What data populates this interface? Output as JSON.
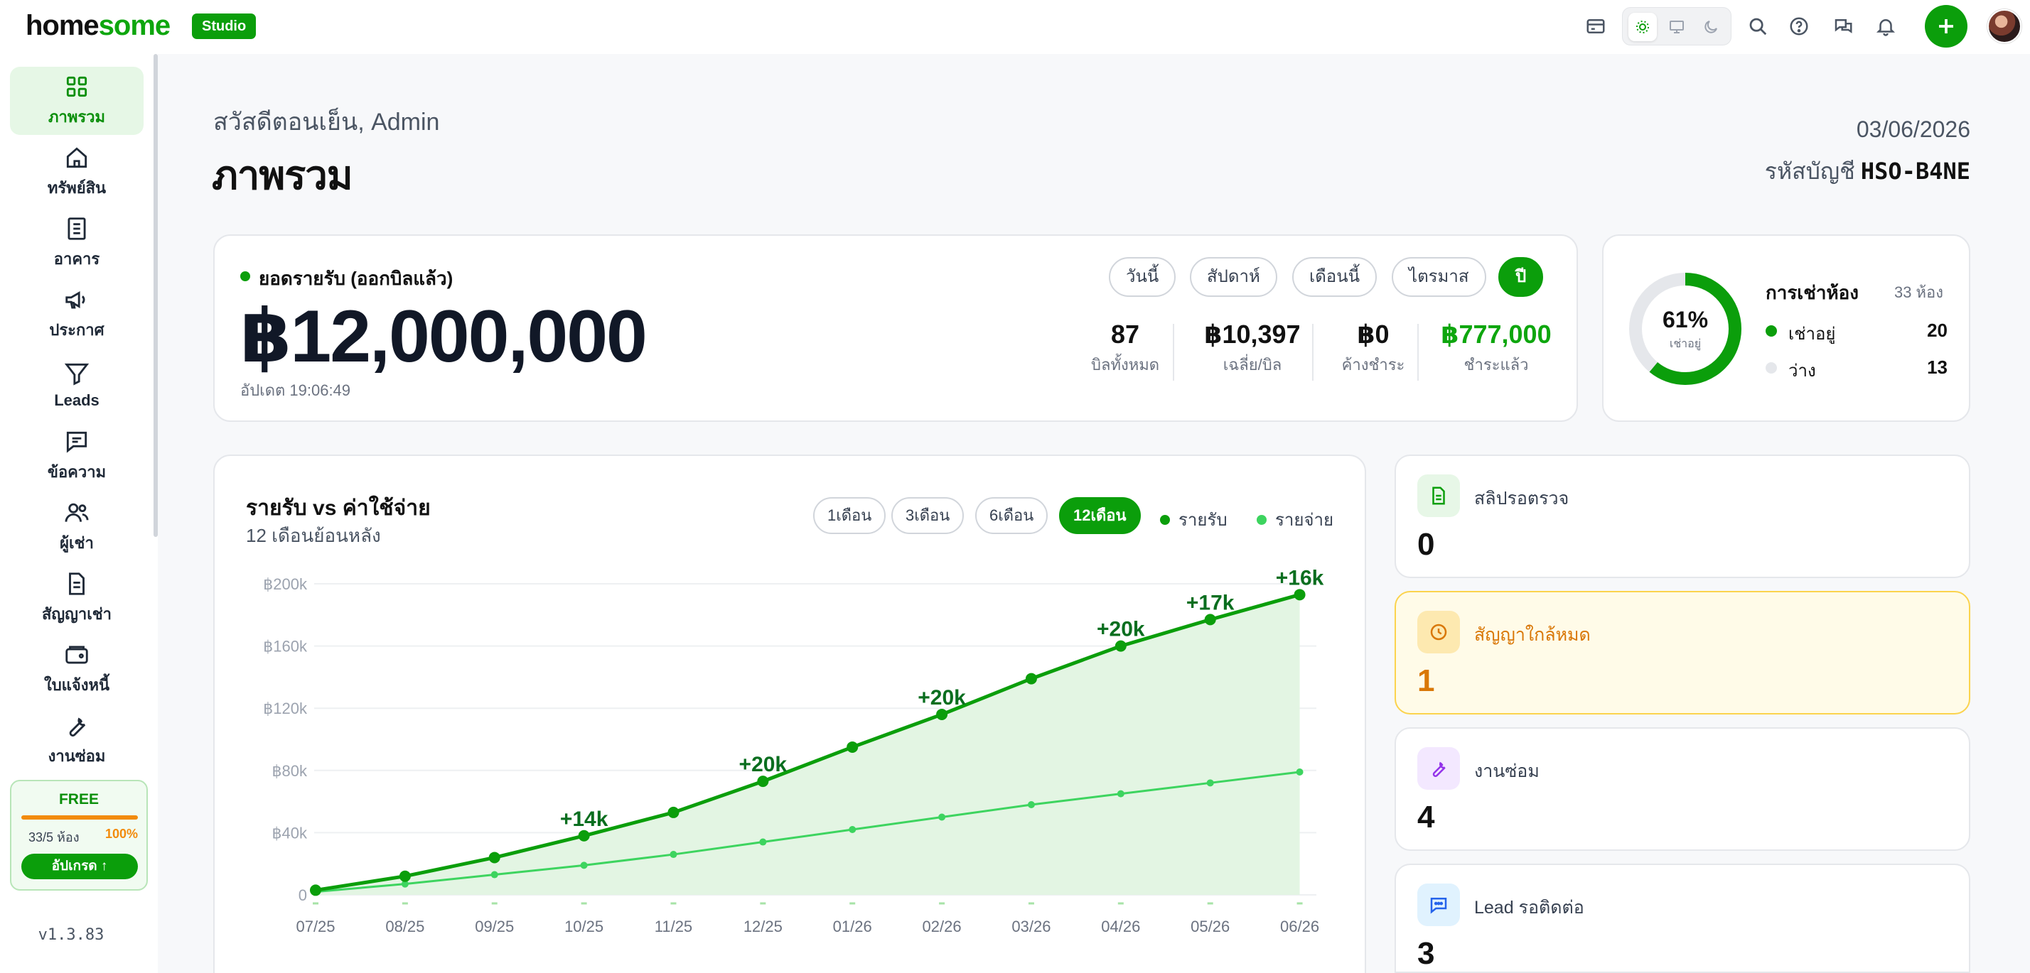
{
  "brand": {
    "name_part1": "home",
    "name_part2": "some",
    "badge": "Studio"
  },
  "colors": {
    "brand_green": "#0b9e0b",
    "light_green": "#3dd45f",
    "warning": "#d97706"
  },
  "sidebar": {
    "items": [
      {
        "label": "ภาพรวม",
        "icon": "grid-icon"
      },
      {
        "label": "ทรัพย์สิน",
        "icon": "home-icon"
      },
      {
        "label": "อาคาร",
        "icon": "building-icon"
      },
      {
        "label": "ประกาศ",
        "icon": "megaphone-icon"
      },
      {
        "label": "Leads",
        "icon": "filter-icon"
      },
      {
        "label": "ข้อความ",
        "icon": "message-icon"
      },
      {
        "label": "ผู้เช่า",
        "icon": "users-icon"
      },
      {
        "label": "สัญญาเช่า",
        "icon": "document-icon"
      },
      {
        "label": "ใบแจ้งหนี้",
        "icon": "wallet-icon"
      },
      {
        "label": "งานซ่อม",
        "icon": "wrench-icon"
      }
    ],
    "plan": {
      "name": "FREE",
      "usage": "33/5 ห้อง",
      "percent": "100%",
      "upgrade": "อัปเกรด ↑"
    },
    "version": "v1.3.83"
  },
  "header": {
    "greeting": "สวัสดีตอนเย็น, Admin",
    "title": "ภาพรวม",
    "date": "03/06/2026",
    "account_label": "รหัสบัญชี",
    "account_code": "HSO-B4NE"
  },
  "revenue": {
    "label": "ยอดรายรับ (ออกบิลแล้ว)",
    "value": "฿12,000,000",
    "updated": "อัปเดต 19:06:49",
    "periods": [
      "วันนี้",
      "สัปดาห์",
      "เดือนนี้",
      "ไตรมาส",
      "ปี"
    ],
    "active_period": "ปี",
    "stats": [
      {
        "value": "87",
        "label": "บิลทั้งหมด"
      },
      {
        "value": "฿10,397",
        "label": "เฉลี่ย/บิล"
      },
      {
        "value": "฿0",
        "label": "ค้างชำระ"
      },
      {
        "value": "฿777,000",
        "label": "ชำระแล้ว"
      }
    ]
  },
  "occupancy": {
    "title": "การเช่าห้อง",
    "total": "33 ห้อง",
    "percent_label": "61%",
    "percent": 61,
    "sub": "เช่าอยู่",
    "rows": [
      {
        "label": "เช่าอยู่",
        "value": "20"
      },
      {
        "label": "ว่าง",
        "value": "13"
      }
    ]
  },
  "chart_panel": {
    "title": "รายรับ vs ค่าใช้จ่าย",
    "subtitle": "12 เดือนย้อนหลัง",
    "ranges": [
      "1เดือน",
      "3เดือน",
      "6เดือน",
      "12เดือน"
    ],
    "active_range": "12เดือน",
    "legend": [
      "รายรับ",
      "รายจ่าย"
    ]
  },
  "chart_data": {
    "type": "area",
    "categories": [
      "07/25",
      "08/25",
      "09/25",
      "10/25",
      "11/25",
      "12/25",
      "01/26",
      "02/26",
      "03/26",
      "04/26",
      "05/26",
      "06/26"
    ],
    "series": [
      {
        "name": "รายรับ",
        "values": [
          3000,
          12000,
          24000,
          38000,
          53000,
          73000,
          95000,
          116000,
          139000,
          160000,
          177000,
          193000
        ],
        "color": "#0b9e0b"
      },
      {
        "name": "รายจ่าย",
        "values": [
          2000,
          7000,
          13000,
          19000,
          26000,
          34000,
          42000,
          50000,
          58000,
          65000,
          72000,
          79000
        ],
        "color": "#3dd45f"
      }
    ],
    "yticks": [
      0,
      40000,
      80000,
      120000,
      160000,
      200000
    ],
    "ytick_labels": [
      "0",
      "฿40k",
      "฿80k",
      "฿120k",
      "฿160k",
      "฿200k"
    ],
    "ylim": [
      0,
      200000
    ],
    "annotations": [
      {
        "index": 3,
        "text": "+14k"
      },
      {
        "index": 5,
        "text": "+20k"
      },
      {
        "index": 7,
        "text": "+20k"
      },
      {
        "index": 9,
        "text": "+20k"
      },
      {
        "index": 10,
        "text": "+17k"
      },
      {
        "index": 11,
        "text": "+16k"
      }
    ],
    "grid": true
  },
  "tiles": [
    {
      "label": "สลิปรอตรวจ",
      "value": "0",
      "icon": "receipt-icon"
    },
    {
      "label": "สัญญาใกล้หมด",
      "value": "1",
      "icon": "clock-icon"
    },
    {
      "label": "งานซ่อม",
      "value": "4",
      "icon": "wrench-icon"
    },
    {
      "label": "Lead รอติดต่อ",
      "value": "3",
      "icon": "chat-icon"
    }
  ]
}
